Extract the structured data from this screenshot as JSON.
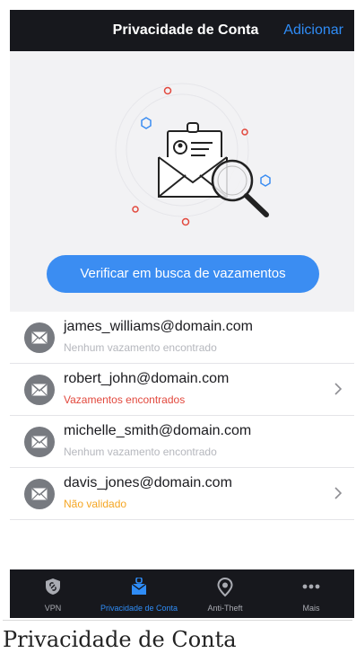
{
  "header": {
    "title": "Privacidade de Conta",
    "action_label": "Adicionar"
  },
  "hero": {
    "button_label": "Verificar em busca de vazamentos",
    "illustration_icon": "envelope-magnifier-icon"
  },
  "accounts": [
    {
      "email": "james_williams@domain.com",
      "status": "Nenhum vazamento encontrado",
      "status_type": "ok",
      "has_chevron": false
    },
    {
      "email": "robert_john@domain.com",
      "status": "Vazamentos encontrados",
      "status_type": "leak",
      "has_chevron": true
    },
    {
      "email": "michelle_smith@domain.com",
      "status": "Nenhum vazamento encontrado",
      "status_type": "ok",
      "has_chevron": false
    },
    {
      "email": "davis_jones@domain.com",
      "status": "Não validado",
      "status_type": "warn",
      "has_chevron": true
    }
  ],
  "tabbar": {
    "tabs": [
      {
        "label": "VPN",
        "icon": "shield-icon"
      },
      {
        "label": "Privacidade de Conta",
        "icon": "account-privacy-icon",
        "active": true
      },
      {
        "label": "Anti-Theft",
        "icon": "location-pin-icon"
      },
      {
        "label": "Mais",
        "icon": "more-dots-icon"
      }
    ]
  },
  "caption": "Privacidade de Conta",
  "colors": {
    "accent": "#2f8cf6",
    "bar_background": "#17181d",
    "leak": "#e2483d",
    "warning": "#f5a623",
    "muted": "#b5b7bd"
  }
}
